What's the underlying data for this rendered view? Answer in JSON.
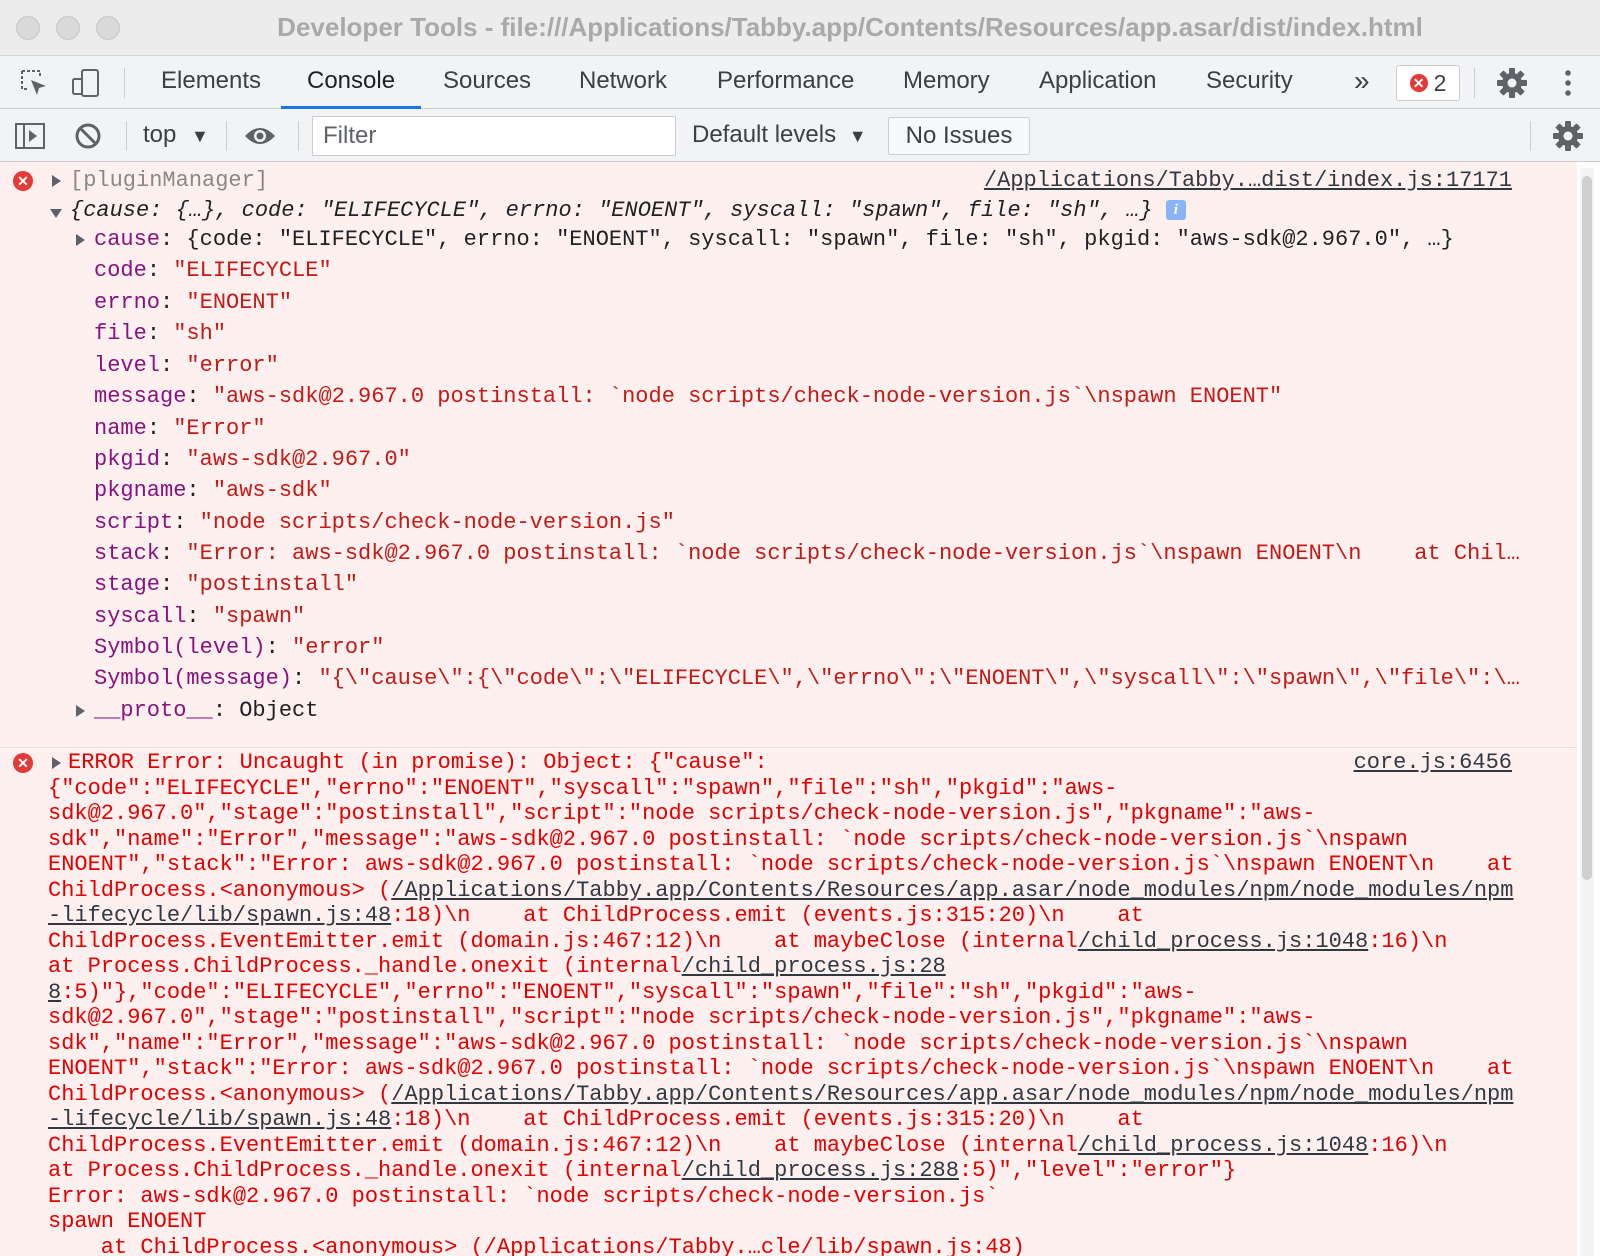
{
  "window": {
    "title": "Developer Tools - file:///Applications/Tabby.app/Contents/Resources/app.asar/dist/index.html"
  },
  "tabs": [
    {
      "label": "Elements"
    },
    {
      "label": "Console"
    },
    {
      "label": "Sources"
    },
    {
      "label": "Network"
    },
    {
      "label": "Performance"
    },
    {
      "label": "Memory"
    },
    {
      "label": "Application"
    },
    {
      "label": "Security"
    }
  ],
  "more_tabs": "»",
  "error_count": "2",
  "toolbar": {
    "context": "top",
    "filter_placeholder": "Filter",
    "levels": "Default levels",
    "issues": "No Issues"
  },
  "messages": {
    "m1": {
      "source": "/Applications/Tabby.…dist/index.js:17171",
      "header": "[pluginManager]",
      "summary": "{cause: {…}, code: \"ELIFECYCLE\", errno: \"ENOENT\", syscall: \"spawn\", file: \"sh\", …}",
      "props": [
        {
          "key": "cause",
          "value": "{code: \"ELIFECYCLE\", errno: \"ENOENT\", syscall: \"spawn\", file: \"sh\", pkgid: \"aws-sdk@2.967.0\", …}"
        },
        {
          "key": "code",
          "value": "\"ELIFECYCLE\""
        },
        {
          "key": "errno",
          "value": "\"ENOENT\""
        },
        {
          "key": "file",
          "value": "\"sh\""
        },
        {
          "key": "level",
          "value": "\"error\""
        },
        {
          "key": "message",
          "value": "\"aws-sdk@2.967.0 postinstall: `node scripts/check-node-version.js`\\nspawn ENOENT\""
        },
        {
          "key": "name",
          "value": "\"Error\""
        },
        {
          "key": "pkgid",
          "value": "\"aws-sdk@2.967.0\""
        },
        {
          "key": "pkgname",
          "value": "\"aws-sdk\""
        },
        {
          "key": "script",
          "value": "\"node scripts/check-node-version.js\""
        },
        {
          "key": "stack",
          "value": "\"Error: aws-sdk@2.967.0 postinstall: `node scripts/check-node-version.js`\\nspawn ENOENT\\n    at Chil…"
        },
        {
          "key": "stage",
          "value": "\"postinstall\""
        },
        {
          "key": "syscall",
          "value": "\"spawn\""
        },
        {
          "key": "Symbol(level)",
          "value": "\"error\""
        },
        {
          "key": "Symbol(message)",
          "value": "\"{\\\"cause\\\":{\\\"code\\\":\\\"ELIFECYCLE\\\",\\\"errno\\\":\\\"ENOENT\\\",\\\"syscall\\\":\\\"spawn\\\",\\\"file\\\":\\…"
        },
        {
          "key": "__proto__",
          "value": "Object"
        }
      ]
    },
    "m2": {
      "source": "core.js:6456",
      "lines": [
        "ERROR Error: Uncaught (in promise): Object: {\"cause\":",
        "{\"code\":\"ELIFECYCLE\",\"errno\":\"ENOENT\",\"syscall\":\"spawn\",\"file\":\"sh\",\"pkgid\":\"aws-",
        "sdk@2.967.0\",\"stage\":\"postinstall\",\"script\":\"node scripts/check-node-version.js\",\"pkgname\":\"aws-",
        "sdk\",\"name\":\"Error\",\"message\":\"aws-sdk@2.967.0 postinstall: `node scripts/check-node-version.js`\\nspawn",
        "ENOENT\",\"stack\":\"Error: aws-sdk@2.967.0 postinstall: `node scripts/check-node-version.js`\\nspawn ENOENT\\n    at"
      ],
      "l6a": "ChildProcess.<anonymous> (",
      "l6b": "/Applications/Tabby.app/Contents/Resources/app.asar/node_modules/npm/node_modules/npm",
      "l7a": "-lifecycle/lib/spawn.js:48",
      "l7b": ":18)\\n    at ChildProcess.emit (events.js:315:20)\\n    at",
      "l8a": "ChildProcess.EventEmitter.emit (domain.js:467:12)\\n    at maybeClose (internal",
      "l8b": "/child_process.js:1048",
      "l8c": ":16)\\n",
      "l9a": "at Process.ChildProcess._handle.onexit (internal",
      "l9b": "/child_process.js:28",
      "l10a": "8",
      "l10b": ":5)\"},\"code\":\"ELIFECYCLE\",\"errno\":\"ENOENT\",\"syscall\":\"spawn\",\"file\":\"sh\",\"pkgid\":\"aws-",
      "lines2": [
        "sdk@2.967.0\",\"stage\":\"postinstall\",\"script\":\"node scripts/check-node-version.js\",\"pkgname\":\"aws-",
        "sdk\",\"name\":\"Error\",\"message\":\"aws-sdk@2.967.0 postinstall: `node scripts/check-node-version.js`\\nspawn",
        "ENOENT\",\"stack\":\"Error: aws-sdk@2.967.0 postinstall: `node scripts/check-node-version.js`\\nspawn ENOENT\\n    at"
      ],
      "l14a": "ChildProcess.<anonymous> (",
      "l14b": "/Applications/Tabby.app/Contents/Resources/app.asar/node_modules/npm/node_modules/npm",
      "l15a": "-lifecycle/lib/spawn.js:48",
      "l15b": ":18)\\n    at ChildProcess.emit (events.js:315:20)\\n    at",
      "l16a": "ChildProcess.EventEmitter.emit (domain.js:467:12)\\n    at maybeClose (internal",
      "l16b": "/child_process.js:1048",
      "l16c": ":16)\\n",
      "l17a": "at Process.ChildProcess._handle.onexit (internal",
      "l17b": "/child_process.js:288",
      "l17c": ":5)\",\"level\":\"error\"}",
      "l18": "Error: aws-sdk@2.967.0 postinstall: `node scripts/check-node-version.js`",
      "l19": "spawn ENOENT",
      "l20": "    at ChildProcess.<anonymous> (/Applications/Tabby.…cle/lib/spawn.js:48)"
    }
  },
  "colors": {
    "accent": "#1a73e8",
    "error": "#e50000",
    "error_bg": "#fff0f0",
    "key": "#881280",
    "string": "#c41a16"
  }
}
